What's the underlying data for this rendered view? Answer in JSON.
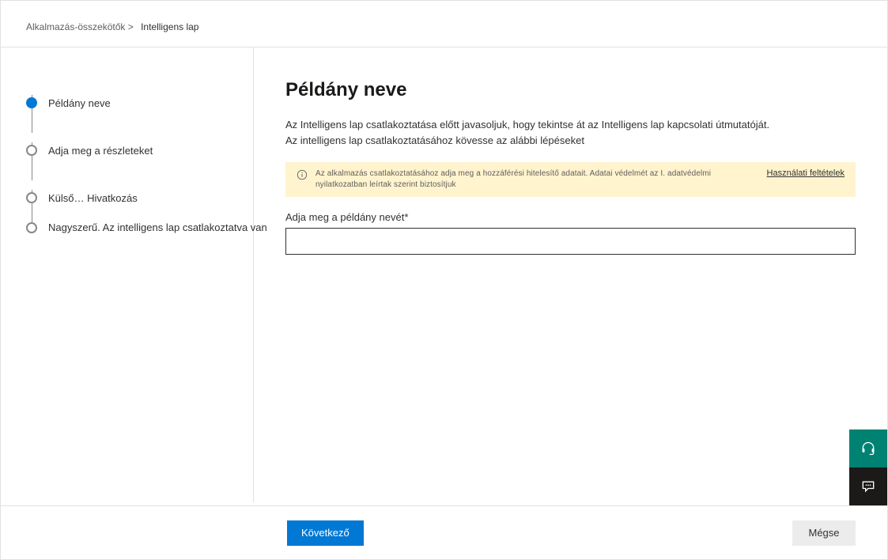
{
  "breadcrumb": {
    "parent": "Alkalmazás-összekötők >",
    "current": "Intelligens lap"
  },
  "stepper": {
    "steps": [
      {
        "label": "Példány neve"
      },
      {
        "label": "Adja meg a részleteket"
      },
      {
        "label": "Külső… Hivatkozás"
      },
      {
        "label": "Nagyszerű. Az intelligens lap csatlakoztatva van"
      }
    ]
  },
  "main": {
    "title": "Példány neve",
    "intro1": "Az Intelligens lap csatlakoztatása előtt javasoljuk, hogy tekintse át az Intelligens lap kapcsolati útmutatóját.",
    "intro2": "Az intelligens lap csatlakoztatásához kövesse az alábbi lépéseket",
    "banner_text": "Az alkalmazás csatlakoztatásához adja meg a hozzáférési hitelesítő adatait. Adatai védelmét az I. adatvédelmi nyilatkozatban leírtak szerint biztosítjuk",
    "banner_link": "Használati feltételek",
    "field_label": "Adja meg a példány nevét*",
    "field_value": ""
  },
  "footer": {
    "next": "Következő",
    "cancel": "Mégse"
  },
  "float": {
    "support": "support-icon",
    "feedback": "feedback-icon"
  }
}
